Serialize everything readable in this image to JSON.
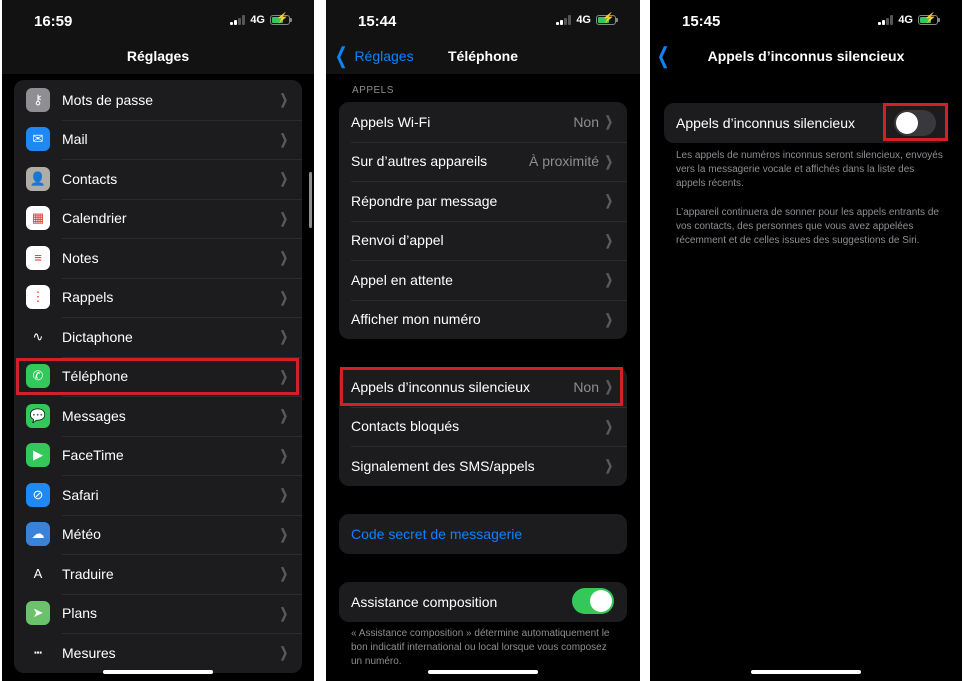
{
  "screens": [
    {
      "status": {
        "time": "16:59",
        "network": "4G"
      },
      "nav": {
        "title": "Réglages"
      },
      "items": [
        {
          "label": "Mots de passe",
          "icon": "key-icon",
          "color": "#8e8e93",
          "glyph": "⚷"
        },
        {
          "label": "Mail",
          "icon": "mail-icon",
          "color": "#1e88f5",
          "glyph": "✉"
        },
        {
          "label": "Contacts",
          "icon": "contacts-icon",
          "color": "#b0aca6",
          "glyph": "👤"
        },
        {
          "label": "Calendrier",
          "icon": "calendar-icon",
          "color": "#ffffff",
          "glyph": "▦"
        },
        {
          "label": "Notes",
          "icon": "notes-icon",
          "color": "#ffffff",
          "glyph": "≡"
        },
        {
          "label": "Rappels",
          "icon": "reminders-icon",
          "color": "#ffffff",
          "glyph": "⋮"
        },
        {
          "label": "Dictaphone",
          "icon": "voice-memos-icon",
          "color": "#1c1c1e",
          "glyph": "∿"
        },
        {
          "label": "Téléphone",
          "icon": "phone-icon",
          "color": "#34c759",
          "glyph": "✆"
        },
        {
          "label": "Messages",
          "icon": "messages-icon",
          "color": "#34c759",
          "glyph": "💬"
        },
        {
          "label": "FaceTime",
          "icon": "facetime-icon",
          "color": "#34c759",
          "glyph": "▶"
        },
        {
          "label": "Safari",
          "icon": "safari-icon",
          "color": "#1e88f5",
          "glyph": "⊘"
        },
        {
          "label": "Météo",
          "icon": "weather-icon",
          "color": "#3a82d8",
          "glyph": "☁"
        },
        {
          "label": "Traduire",
          "icon": "translate-icon",
          "color": "#1c1c1e",
          "glyph": "A"
        },
        {
          "label": "Plans",
          "icon": "maps-icon",
          "color": "#6cc26c",
          "glyph": "➤"
        },
        {
          "label": "Mesures",
          "icon": "measure-icon",
          "color": "#1c1c1e",
          "glyph": "┅"
        }
      ],
      "highlighted": "Téléphone"
    },
    {
      "status": {
        "time": "15:44",
        "network": "4G"
      },
      "nav": {
        "title": "Téléphone",
        "back": "Réglages"
      },
      "section_header": "APPELS",
      "group1": [
        {
          "label": "Appels Wi-Fi",
          "value": "Non"
        },
        {
          "label": "Sur d’autres appareils",
          "value": "À proximité"
        },
        {
          "label": "Répondre par message",
          "value": ""
        },
        {
          "label": "Renvoi d’appel",
          "value": ""
        },
        {
          "label": "Appel en attente",
          "value": ""
        },
        {
          "label": "Afficher mon numéro",
          "value": ""
        }
      ],
      "group2": [
        {
          "label": "Appels d’inconnus silencieux",
          "value": "Non"
        },
        {
          "label": "Contacts bloqués",
          "value": ""
        },
        {
          "label": "Signalement des SMS/appels",
          "value": ""
        }
      ],
      "voicemail_link": "Code secret de messagerie",
      "dial_assist": {
        "label": "Assistance composition",
        "on": true
      },
      "dial_assist_footnote": "« Assistance composition » détermine automatiquement le bon indicatif international ou local lorsque vous composez un numéro.",
      "highlighted": "Appels d’inconnus silencieux"
    },
    {
      "status": {
        "time": "15:45",
        "network": "4G"
      },
      "nav": {
        "title": "Appels d’inconnus silencieux"
      },
      "toggle_row": {
        "label": "Appels d’inconnus silencieux",
        "on": false
      },
      "footnote1": "Les appels de numéros inconnus seront silencieux, envoyés vers la messagerie vocale et affichés dans la liste des appels récents.",
      "footnote2": "L’appareil continuera de sonner pour les appels entrants de vos contacts, des personnes que vous avez appelées récemment et de celles issues des suggestions de Siri."
    }
  ],
  "colors": {
    "highlight": "#d32027",
    "accent": "#0a84ff",
    "switch_on": "#34c759"
  }
}
